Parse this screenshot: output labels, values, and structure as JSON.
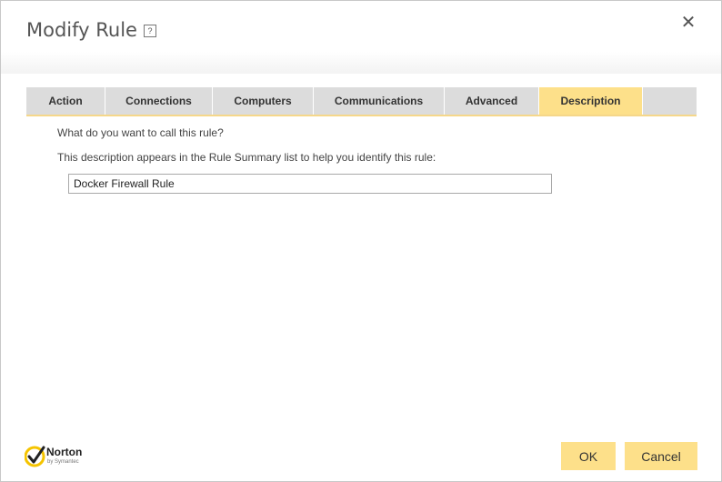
{
  "window": {
    "title": "Modify Rule",
    "help_label": "?",
    "close_label": "✕"
  },
  "tabs": [
    {
      "label": "Action",
      "active": false
    },
    {
      "label": "Connections",
      "active": false
    },
    {
      "label": "Computers",
      "active": false
    },
    {
      "label": "Communications",
      "active": false
    },
    {
      "label": "Advanced",
      "active": false
    },
    {
      "label": "Description",
      "active": true
    }
  ],
  "description": {
    "question": "What do you want to call this rule?",
    "hint": "This description appears in the Rule Summary list to help you identify this rule:",
    "rule_name_value": "Docker Firewall Rule"
  },
  "branding": {
    "logo_text": "Norton",
    "logo_sub": "by Symantec"
  },
  "buttons": {
    "ok_label": "OK",
    "cancel_label": "Cancel"
  },
  "colors": {
    "accent": "#fde08a",
    "tab_background": "#dcdcdc"
  }
}
